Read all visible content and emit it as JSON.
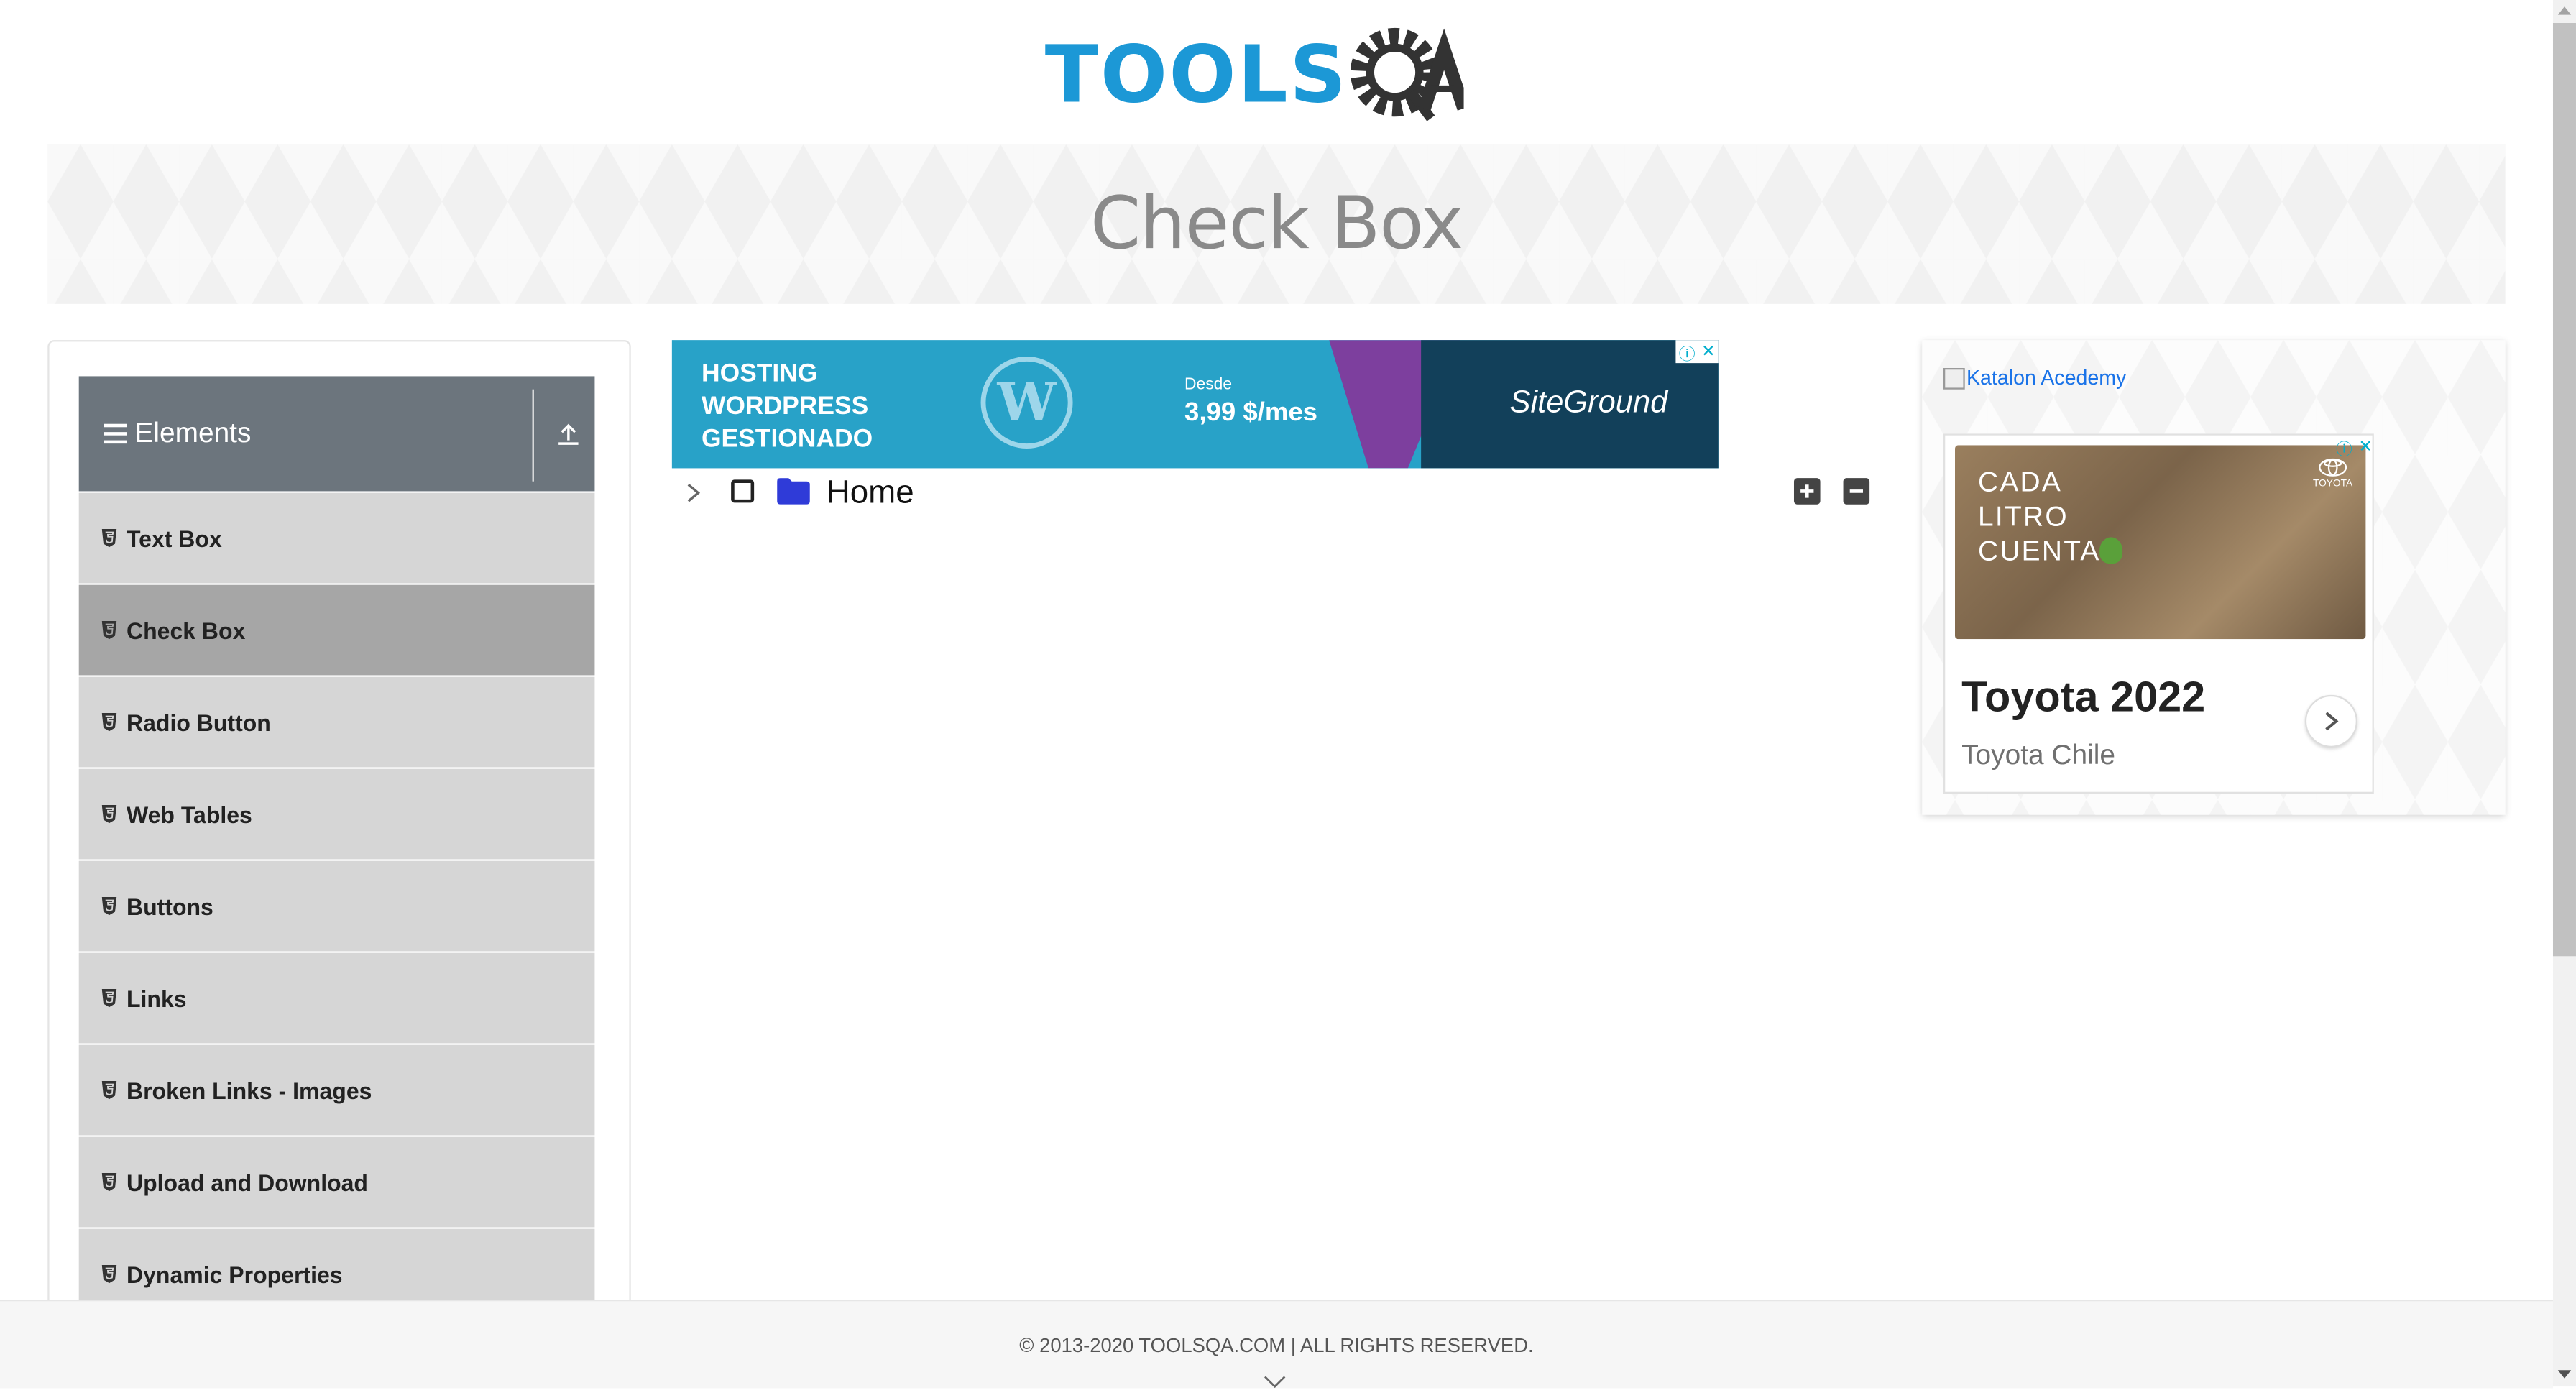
{
  "header": {
    "logo_text": "TOOLS",
    "logo_suffix": "QA"
  },
  "banner": {
    "title": "Check Box"
  },
  "sidebar": {
    "group_title": "Elements",
    "items": [
      {
        "label": "Text Box",
        "active": false
      },
      {
        "label": "Check Box",
        "active": true
      },
      {
        "label": "Radio Button",
        "active": false
      },
      {
        "label": "Web Tables",
        "active": false
      },
      {
        "label": "Buttons",
        "active": false
      },
      {
        "label": "Links",
        "active": false
      },
      {
        "label": "Broken Links - Images",
        "active": false
      },
      {
        "label": "Upload and Download",
        "active": false
      },
      {
        "label": "Dynamic Properties",
        "active": false
      }
    ]
  },
  "ad_top": {
    "headline": "HOSTING WORDPRESS GESTIONADO",
    "desde": "Desde",
    "price": "3,99 $/mes",
    "brand": "SiteGround"
  },
  "tree": {
    "root_label": "Home",
    "checked": false,
    "expanded": false
  },
  "right_ad": {
    "katalon_alt": "Katalon Acedemy",
    "image_text": "CADA LITRO CUENTA",
    "image_brand": "TOYOTA",
    "title": "Toyota 2022",
    "subtitle": "Toyota Chile"
  },
  "footer": {
    "text": "© 2013-2020 TOOLSQA.COM | ALL RIGHTS RESERVED."
  },
  "colors": {
    "logo_blue": "#1c98d6",
    "logo_dark": "#333333",
    "sidebar_header": "#6c757d",
    "menu_item": "#d6d6d6",
    "menu_item_active": "#a6a6a6",
    "folder": "#2f3bd8"
  }
}
